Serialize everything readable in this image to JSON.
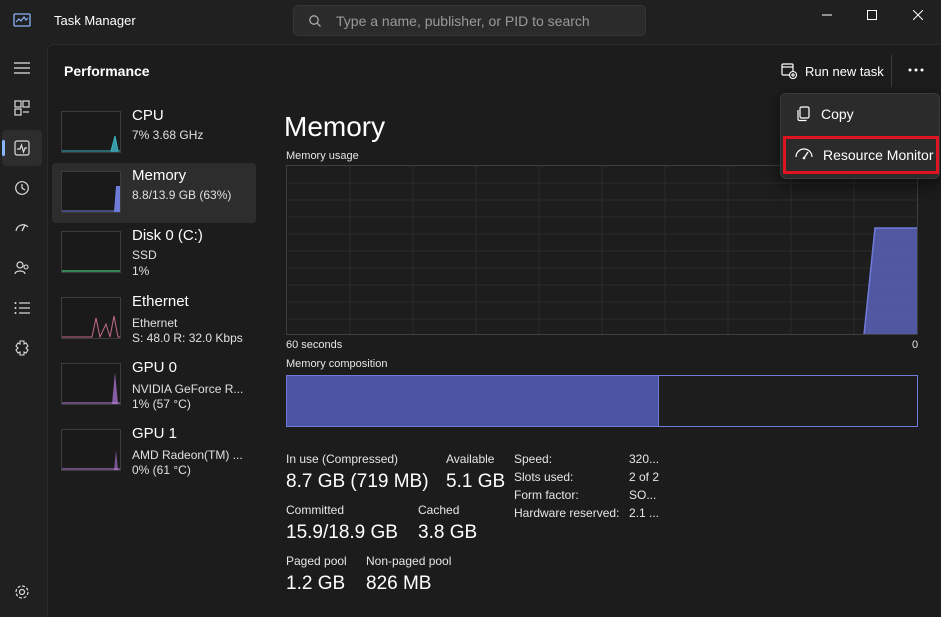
{
  "window": {
    "title": "Task Manager",
    "search_placeholder": "Type a name, publisher, or PID to search"
  },
  "header": {
    "title": "Performance",
    "run_task_label": "Run new task",
    "more_label": "..."
  },
  "nav": {
    "items": [
      "menu-icon",
      "processes-icon",
      "performance-icon",
      "app-history-icon",
      "startup-apps-icon",
      "users-icon",
      "details-icon",
      "services-icon",
      "settings-icon"
    ],
    "active": "performance"
  },
  "devices": [
    {
      "name": "CPU",
      "lines": [
        "7%  3.68 GHz"
      ]
    },
    {
      "name": "Memory",
      "lines": [
        "8.8/13.9 GB (63%)"
      ]
    },
    {
      "name": "Disk 0 (C:)",
      "lines": [
        "SSD",
        "1%"
      ]
    },
    {
      "name": "Ethernet",
      "lines": [
        "Ethernet",
        "S: 48.0  R: 32.0 Kbps"
      ]
    },
    {
      "name": "GPU 0",
      "lines": [
        "NVIDIA GeForce R...",
        "1%  (57 °C)"
      ]
    },
    {
      "name": "GPU 1",
      "lines": [
        "AMD Radeon(TM) ...",
        "0%  (61 °C)"
      ]
    }
  ],
  "memory": {
    "title": "Memory",
    "usage_label": "Memory usage",
    "time_label": "60 seconds",
    "zero_label": "0",
    "composition_label": "Memory composition",
    "composition_in_use_fraction": 0.59,
    "in_use_label": "In use (Compressed)",
    "in_use_value": "8.7 GB (719 MB)",
    "available_label": "Available",
    "available_value": "5.1 GB",
    "committed_label": "Committed",
    "committed_value": "15.9/18.9 GB",
    "cached_label": "Cached",
    "cached_value": "3.8 GB",
    "paged_label": "Paged pool",
    "paged_value": "1.2 GB",
    "nonpaged_label": "Non-paged pool",
    "nonpaged_value": "826 MB",
    "props": [
      {
        "key": "Speed:",
        "value": "320..."
      },
      {
        "key": "Slots used:",
        "value": "2 of 2"
      },
      {
        "key": "Form factor:",
        "value": "SO..."
      },
      {
        "key": "Hardware reserved:",
        "value": "2.1 ..."
      }
    ]
  },
  "context_menu": {
    "items": [
      "Copy",
      "Resource Monitor"
    ],
    "highlight_color": "#e0141e"
  },
  "colors": {
    "memory_accent": "#6e7bd9",
    "cpu_accent": "#3fb6c4",
    "disk_accent": "#4cc27a",
    "net_accent": "#c46b8a",
    "gpu_accent": "#b77be0"
  }
}
